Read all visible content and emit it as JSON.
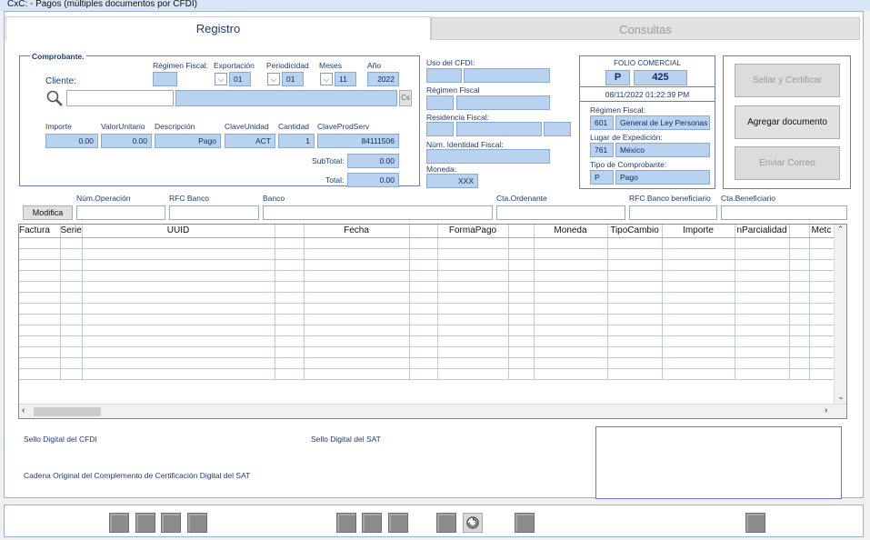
{
  "window": {
    "title": "CxC: - Pagos (múltiples documentos por CFDI)"
  },
  "tabs": {
    "registro": "Registro",
    "consultas": "Consultas"
  },
  "comprobante": {
    "group_label": "Comprobante.",
    "cliente_label": "Cliente:",
    "cliente_value": "",
    "cs_button": "Cs",
    "regimen_fiscal_label": "Régimen Fiscal:",
    "regimen_fiscal_value": "",
    "exportacion_label": "Exportación",
    "exportacion_value": "01",
    "periodicidad_label": "Periodicidad",
    "periodicidad_value": "01",
    "meses_label": "Meses",
    "meses_value": "11",
    "anio_label": "Año",
    "anio_value": "2022",
    "importe_label": "Importe",
    "importe_value": "0.00",
    "valorunitario_label": "ValorUnitario",
    "valorunitario_value": "0.00",
    "descripcion_label": "Descripción",
    "descripcion_value": "Pago",
    "claveunidad_label": "ClaveUnidad",
    "claveunidad_value": "ACT",
    "cantidad_label": "Cantidad",
    "cantidad_value": "1",
    "claveprodserv_label": "ClaveProdServ",
    "claveprodserv_value": "84111506",
    "subtotal_label": "SubTotal:",
    "subtotal_value": "0.00",
    "total_label": "Total:",
    "total_value": "0.00"
  },
  "receptor": {
    "uso_cfdi_label": "Uso del CFDI:",
    "regimen_fiscal_label": "Régimen Fiscal",
    "residencia_fiscal_label": "Residencia Fiscal:",
    "num_id_fiscal_label": "Núm. Identidad Fiscal:",
    "moneda_label": "Moneda:",
    "moneda_value": "XXX"
  },
  "folio": {
    "title": "FOLIO COMERCIAL",
    "serie": "P",
    "numero": "425",
    "fecha": "08/11/2022 01:22:39 PM",
    "regimen_label": "Régimen Fiscal:",
    "regimen_code": "601",
    "regimen_desc": "General de Ley Personas",
    "lugar_label": "Lugar de Expedición:",
    "lugar_code": "761",
    "lugar_desc": "México",
    "tipo_label": "Tipo de Comprobante:",
    "tipo_code": "P",
    "tipo_desc": "Pago"
  },
  "actions": {
    "sellar": "Sellar y Certificar",
    "agregar": "Agregar documento",
    "enviar": "Enviar Correo"
  },
  "operacion": {
    "modifica_button": "Modifica",
    "num_operacion_label": "Núm.Operación",
    "rfc_banco_label": "RFC Banco",
    "banco_label": "Banco",
    "cta_ordenante_label": "Cta.Ordenante",
    "rfc_banco_benef_label": "RFC Banco beneficiario",
    "cta_beneficiario_label": "Cta.Beneficiario"
  },
  "grid": {
    "columns": [
      "Factura",
      "Serie",
      "UUID",
      "",
      "Fecha",
      "",
      "FormaPago",
      "",
      "Moneda",
      "TipoCambio",
      "Importe",
      "nParcialidad",
      "",
      "Metc"
    ]
  },
  "sellos": {
    "sello_cfdi_label": "Sello Digital del CFDI",
    "sello_sat_label": "Sello Digital del SAT",
    "cadena_label": "Cadena Original del Complemento de Certificación Digital del SAT"
  },
  "icons": {
    "search": "search-icon",
    "refresh": "refresh-icon"
  }
}
